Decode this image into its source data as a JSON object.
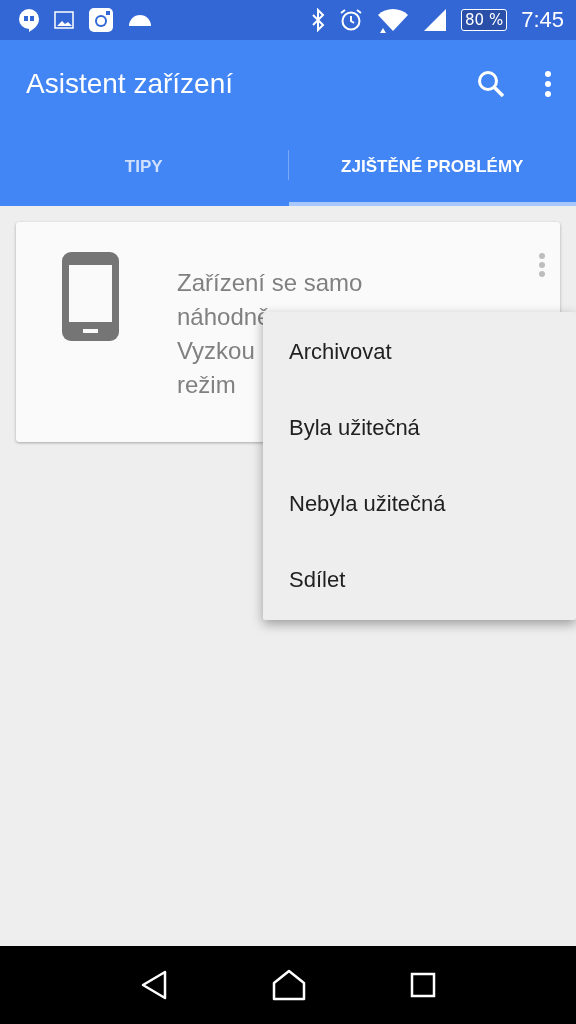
{
  "status_bar": {
    "battery": "80 %",
    "time": "7:45"
  },
  "app_bar": {
    "title": "Asistent zařízení"
  },
  "tabs": [
    {
      "label": "TIPY",
      "selected": false
    },
    {
      "label": "ZJIŠTĚNÉ PROBLÉMY",
      "selected": true
    }
  ],
  "card": {
    "lines": [
      "Zařízení se samo",
      "náhodně",
      "Vyzkou",
      "režim"
    ]
  },
  "menu": {
    "items": [
      "Archivovat",
      "Byla užitečná",
      "Nebyla užitečná",
      "Sdílet"
    ]
  }
}
